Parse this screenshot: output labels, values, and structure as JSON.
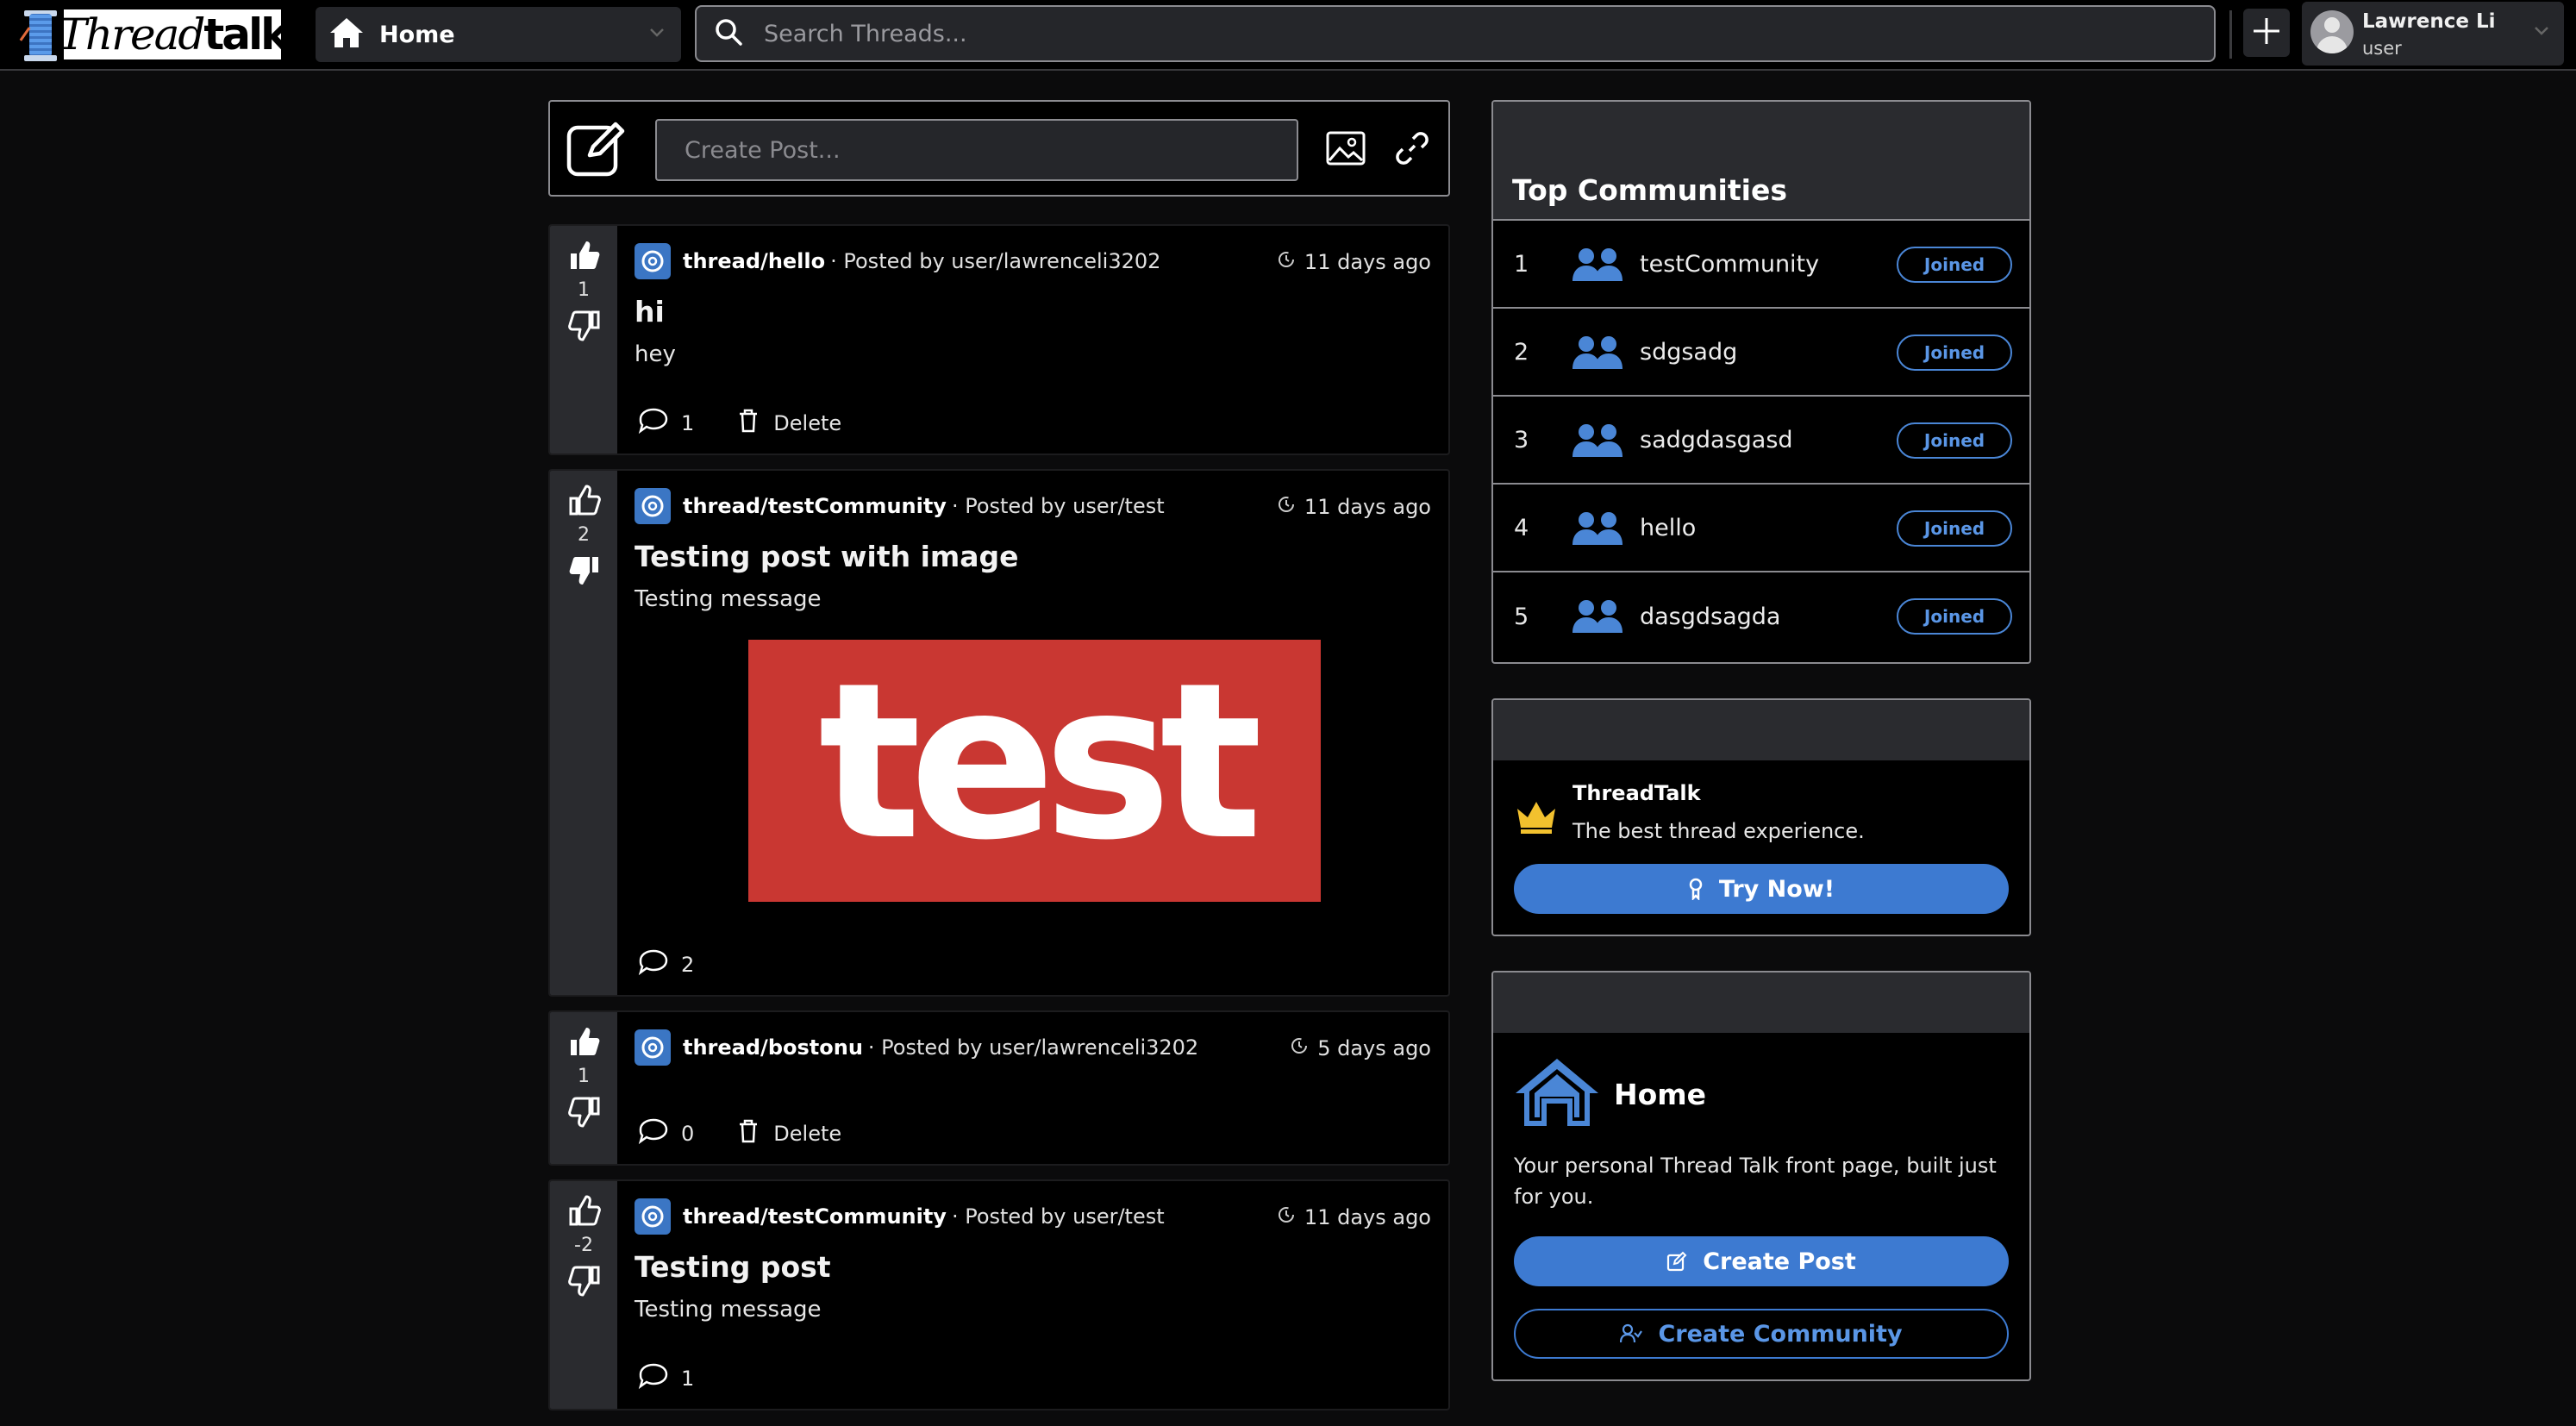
{
  "header": {
    "logo_text_script": "Thread",
    "logo_text_bold": "talk",
    "home_label": "Home",
    "search_placeholder": "Search Threads...",
    "user": {
      "name": "Lawrence Li",
      "role": "user"
    }
  },
  "create_post": {
    "placeholder": "Create Post..."
  },
  "posts": [
    {
      "score": "1",
      "community": "thread/hello",
      "posted_by": "· Posted by user/lawrenceli3202",
      "time": "11 days ago",
      "title": "hi",
      "body": "hey",
      "comments": "1",
      "delete_label": "Delete"
    },
    {
      "score": "2",
      "community": "thread/testCommunity",
      "posted_by": "· Posted by user/test",
      "time": "11 days ago",
      "title": "Testing post with image",
      "body": "Testing message",
      "image_text": "test",
      "comments": "2"
    },
    {
      "score": "1",
      "community": "thread/bostonu",
      "posted_by": "· Posted by user/lawrenceli3202",
      "time": "5 days ago",
      "comments": "0",
      "delete_label": "Delete"
    },
    {
      "score": "-2",
      "community": "thread/testCommunity",
      "posted_by": "· Posted by user/test",
      "time": "11 days ago",
      "title": "Testing post",
      "body": "Testing message",
      "comments": "1"
    }
  ],
  "top_communities": {
    "title": "Top Communities",
    "items": [
      {
        "rank": "1",
        "name": "testCommunity",
        "status": "Joined"
      },
      {
        "rank": "2",
        "name": "sdgsadg",
        "status": "Joined"
      },
      {
        "rank": "3",
        "name": "sadgdasgasd",
        "status": "Joined"
      },
      {
        "rank": "4",
        "name": "hello",
        "status": "Joined"
      },
      {
        "rank": "5",
        "name": "dasgdsagda",
        "status": "Joined"
      }
    ]
  },
  "promo": {
    "title": "ThreadTalk",
    "subtitle": "The best thread experience.",
    "button": "Try Now!"
  },
  "home_card": {
    "title": "Home",
    "description": "Your personal Thread Talk front page, built just for you.",
    "create_post": "Create Post",
    "create_community": "Create Community"
  },
  "colors": {
    "accent": "#3d7ad1",
    "panel": "#2a2b2f",
    "background": "#0b0b0c"
  }
}
